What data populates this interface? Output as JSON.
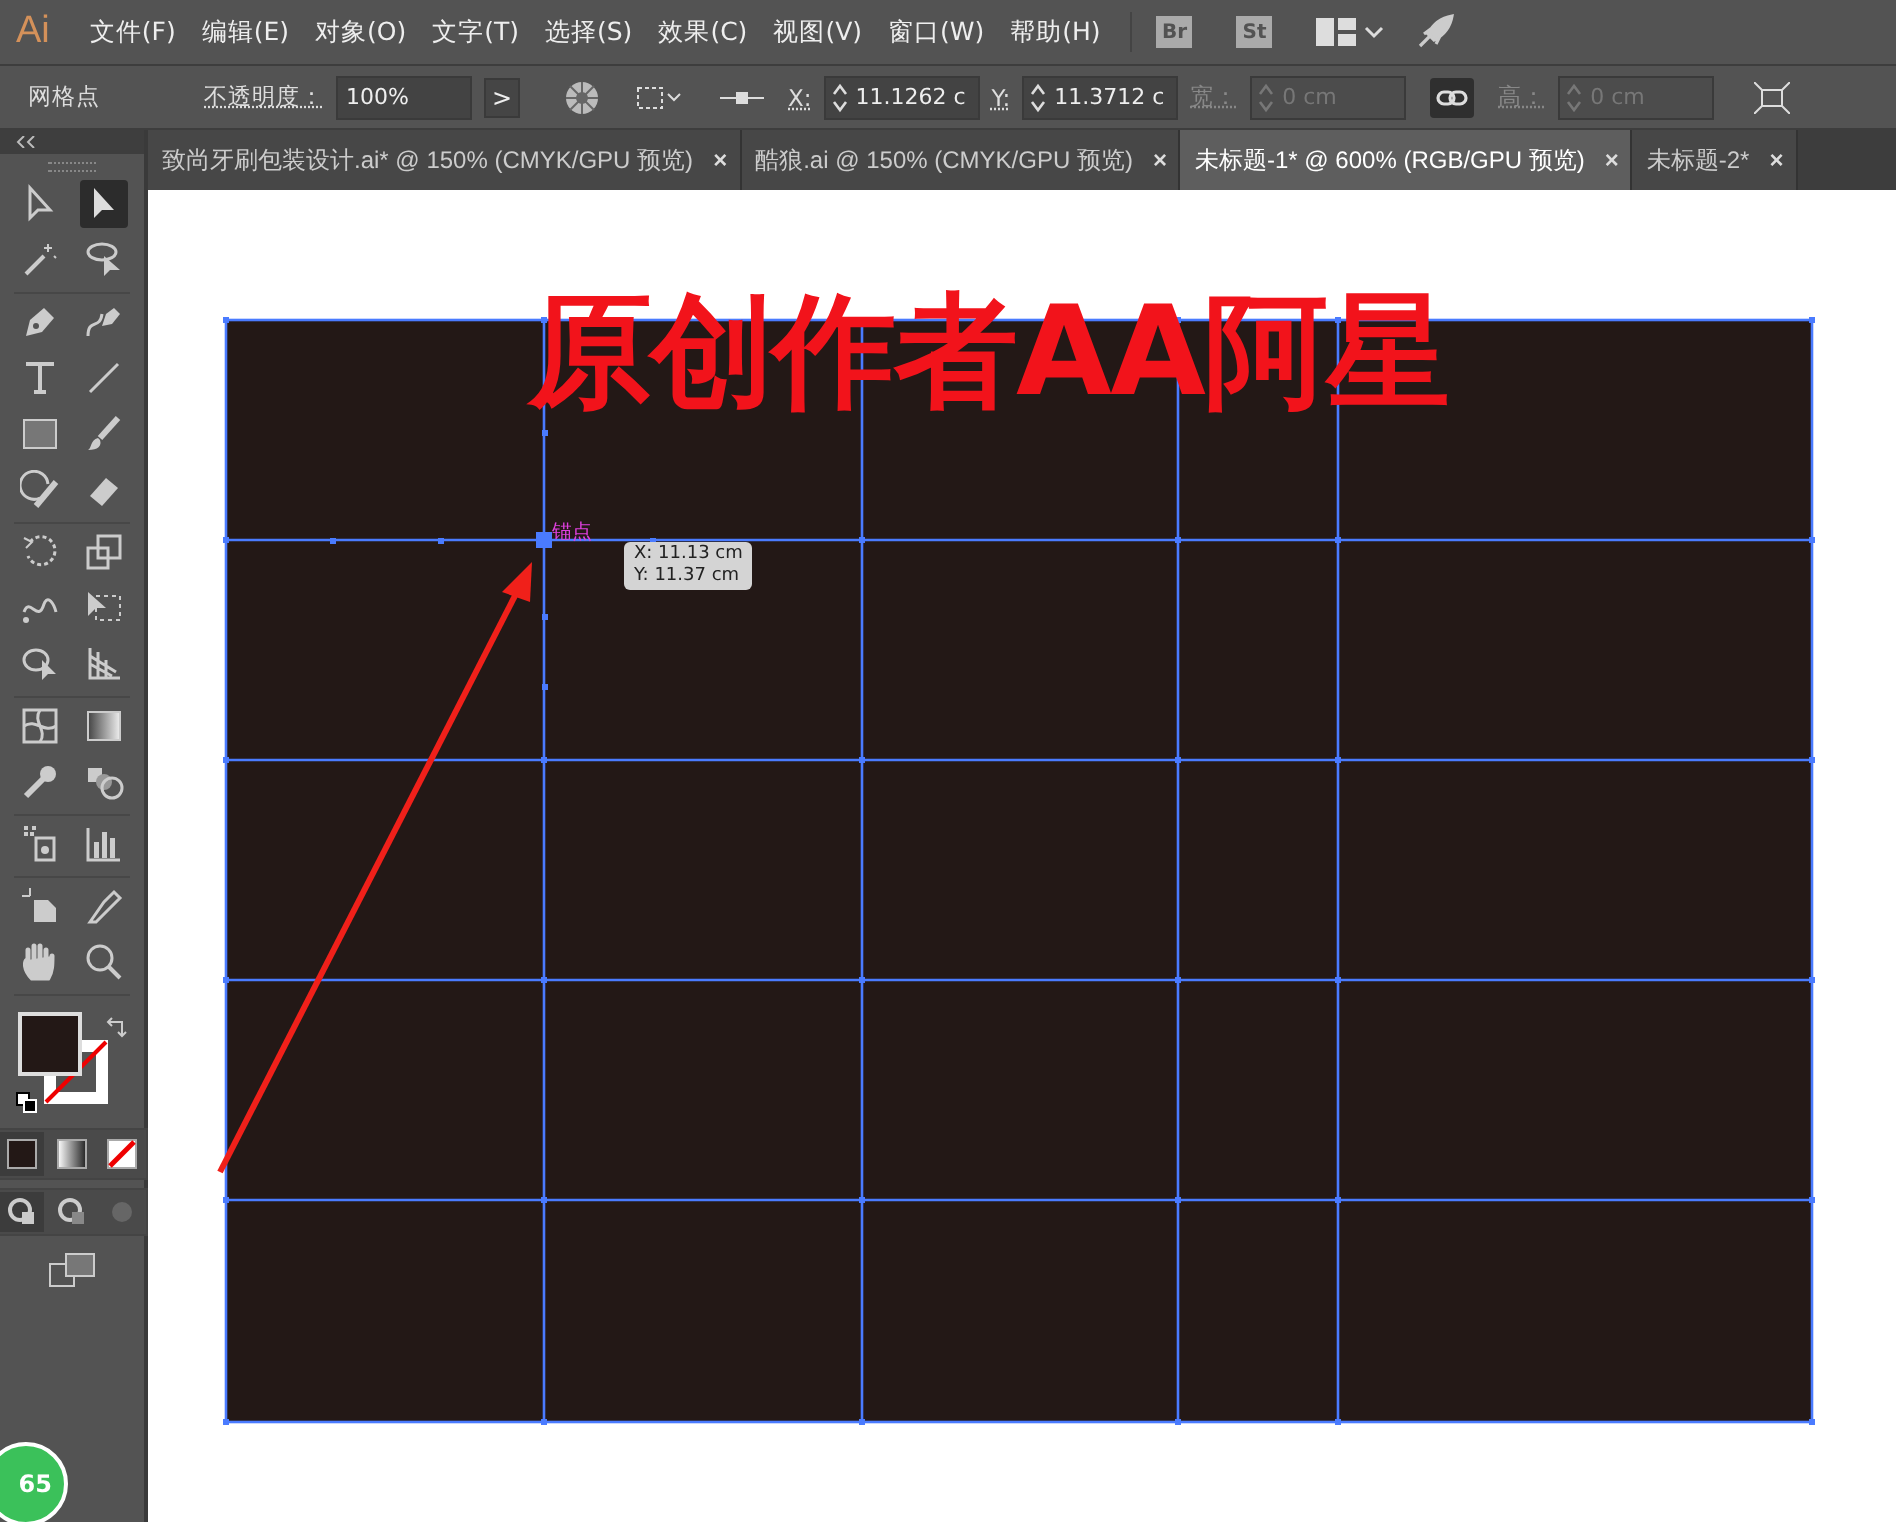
{
  "app_logo": "Ai",
  "menus": [
    "文件(F)",
    "编辑(E)",
    "对象(O)",
    "文字(T)",
    "选择(S)",
    "效果(C)",
    "视图(V)",
    "窗口(W)",
    "帮助(H)"
  ],
  "app_switchers": [
    "Br",
    "St"
  ],
  "control_bar": {
    "selection_label": "网格点",
    "opacity_label": "不透明度：",
    "opacity_value": "100%",
    "opacity_button": ">",
    "x_label": "X:",
    "x_value": "11.1262 c",
    "y_label": "Y:",
    "y_value": "11.3712 c",
    "width_label": "宽：",
    "width_value": "0 cm",
    "width_disabled": true,
    "height_label": "高：",
    "height_value": "0 cm",
    "height_disabled": true
  },
  "tabs": [
    {
      "label": "致尚牙刷包装设计.ai* @ 150% (CMYK/GPU 预览)",
      "close": "×",
      "selected": false
    },
    {
      "label": "酷狼.ai @ 150% (CMYK/GPU 预览)",
      "close": "×",
      "selected": false
    },
    {
      "label": "未标题-1* @ 600% (RGB/GPU 预览)",
      "close": "×",
      "selected": true
    },
    {
      "label": "未标题-2*",
      "close": "×",
      "selected": false
    }
  ],
  "tool_groups": [
    [
      {
        "kind": "select",
        "selected": false
      },
      {
        "kind": "direct",
        "selected": true
      },
      {
        "kind": "wand",
        "selected": false
      },
      {
        "kind": "lasso",
        "selected": false
      }
    ],
    [
      {
        "kind": "pen",
        "selected": false
      },
      {
        "kind": "curvature",
        "selected": false
      },
      {
        "kind": "type",
        "selected": false
      },
      {
        "kind": "line",
        "selected": false
      },
      {
        "kind": "rect",
        "selected": false
      },
      {
        "kind": "brush",
        "selected": false
      },
      {
        "kind": "shaper",
        "selected": false
      },
      {
        "kind": "eraser",
        "selected": false
      }
    ],
    [
      {
        "kind": "rotate",
        "selected": false
      },
      {
        "kind": "scale",
        "selected": false
      },
      {
        "kind": "warp",
        "selected": false
      },
      {
        "kind": "freetransform",
        "selected": false
      },
      {
        "kind": "shapebuilder",
        "selected": false
      },
      {
        "kind": "perspective",
        "selected": false
      }
    ],
    [
      {
        "kind": "mesh",
        "selected": false
      },
      {
        "kind": "gradient",
        "selected": false
      },
      {
        "kind": "eyedropper",
        "selected": false
      },
      {
        "kind": "blend",
        "selected": false
      }
    ],
    [
      {
        "kind": "sprayer",
        "selected": false
      },
      {
        "kind": "graph",
        "selected": false
      }
    ],
    [
      {
        "kind": "artboard",
        "selected": false
      },
      {
        "kind": "slice",
        "selected": false
      },
      {
        "kind": "hand",
        "selected": false
      },
      {
        "kind": "zoom",
        "selected": false
      }
    ]
  ],
  "canvas": {
    "anchor_label": "锚点",
    "tooltip": [
      "X: 11.13 cm",
      "Y: 11.37 cm"
    ],
    "overlay_text": "原创作者AA阿星"
  },
  "corner_badge": "65"
}
